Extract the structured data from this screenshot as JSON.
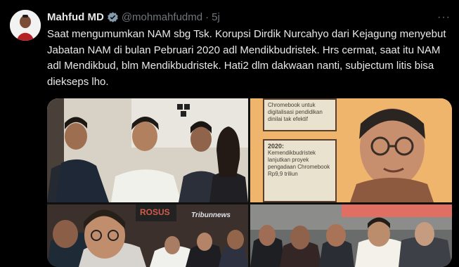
{
  "tweet": {
    "author_name": "Mahfud MD",
    "handle": "@mohmahfudmd",
    "separator": "·",
    "time": "5j",
    "more_icon": "···",
    "text": "Saat mengumumkan NAM sbg Tsk. Korupsi Dirdik Nurcahyo dari Kejagung menyebut Jabatan NAM di bulan Pebruari 2020 adl Mendikbudristek. Hrs cermat, saat itu NAM adl Mendikbud, blm Mendikbudristek. Hati2 dlm dakwaan nanti, subjectum litis bisa diekseps lho."
  },
  "media": {
    "image2": {
      "box1_text": "Chromebook untuk digitalisasi pendidikan dinilai tak efektif",
      "box2_title": "2020:",
      "box2_text": "Kemendikbudristek lanjutkan proyek pengadaan Chromebook Rp9,9 triliun"
    },
    "image3": {
      "sign_text": "ROSUS",
      "watermark": "Tribunnews"
    }
  },
  "colors": {
    "verified": "#829aab",
    "secondary_text": "#71767b"
  }
}
